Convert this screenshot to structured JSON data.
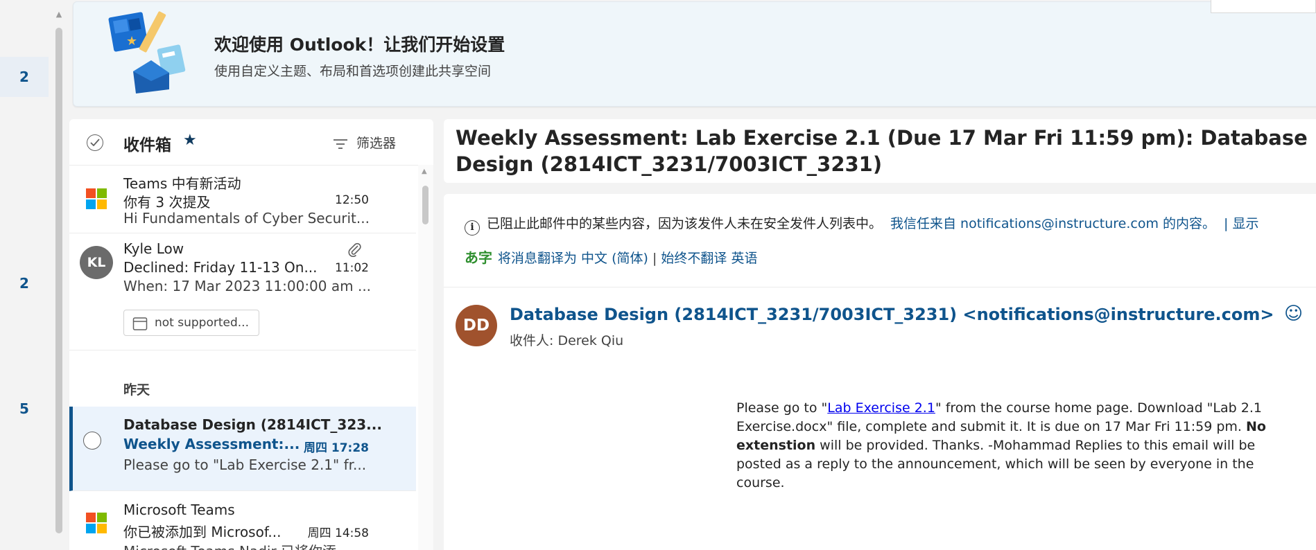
{
  "rail": {
    "counts": [
      "2",
      "2",
      "5"
    ]
  },
  "banner": {
    "title": "欢迎使用 Outlook！让我们开始设置",
    "subtitle": "使用自定义主题、布局和首选项创建此共享空间"
  },
  "list": {
    "folder": "收件箱",
    "filter_label": "筛选器",
    "group_yesterday": "昨天",
    "items": [
      {
        "sender": "Teams 中有新活动",
        "subject": "你有 3 次提及",
        "time": "12:50",
        "preview": "Hi Fundamentals of Cyber Securit..."
      },
      {
        "sender": "Kyle Low",
        "avatar_initials": "KL",
        "subject": "Declined: Friday 11-13 On...",
        "time": "11:02",
        "preview": "When: 17 Mar 2023 11:00:00 am ...",
        "attachment": "not supported..."
      },
      {
        "sender": "Database Design (2814ICT_323...",
        "subject": "Weekly Assessment:...",
        "time": "周四 17:28",
        "preview": "Please go to \"Lab Exercise 2.1\" fr..."
      },
      {
        "sender": "Microsoft Teams",
        "subject": "你已被添加到 Microsof...",
        "time": "周四 14:58",
        "preview": "Microsoft Teams Nadir 已将你添..."
      }
    ]
  },
  "message": {
    "subject": "Weekly Assessment: Lab Exercise 2.1 (Due 17 Mar Fri 11:59 pm): Database Design (2814ICT_3231/7003ICT_3231)",
    "blocked_notice": "已阻止此邮件中的某些内容，因为该发件人未在安全发件人列表中。",
    "trust_link": "我信任来自 notifications@instructure.com 的内容。",
    "show_link": "| 显示",
    "translate_link": "将消息翻译为 中文 (简体)",
    "translate_sep": "|",
    "never_translate": "始终不翻译 英语",
    "from_initials": "DD",
    "from": "Database Design (2814ICT_3231/7003ICT_3231) <notifications@instructure.com>",
    "to_label": "收件人:",
    "to": "Derek Qiu",
    "body": {
      "p1": "Please go to \"",
      "link": "Lab Exercise 2.1",
      "p2": "\" from the course home page. Download \"Lab 2.1 Exercise.docx\" file, complete and submit it. It is due on 17 Mar Fri 11:59 pm. ",
      "bold": "No extenstion",
      "p3": " will be provided. Thanks. -Mohammad Replies to this email will be posted as a reply to the announcement, which will be seen by everyone in the course."
    }
  },
  "colors": {
    "accent": "#0f548c",
    "avatar_dd": "#a0522d",
    "avatar_kl": "#6b6b6b"
  }
}
